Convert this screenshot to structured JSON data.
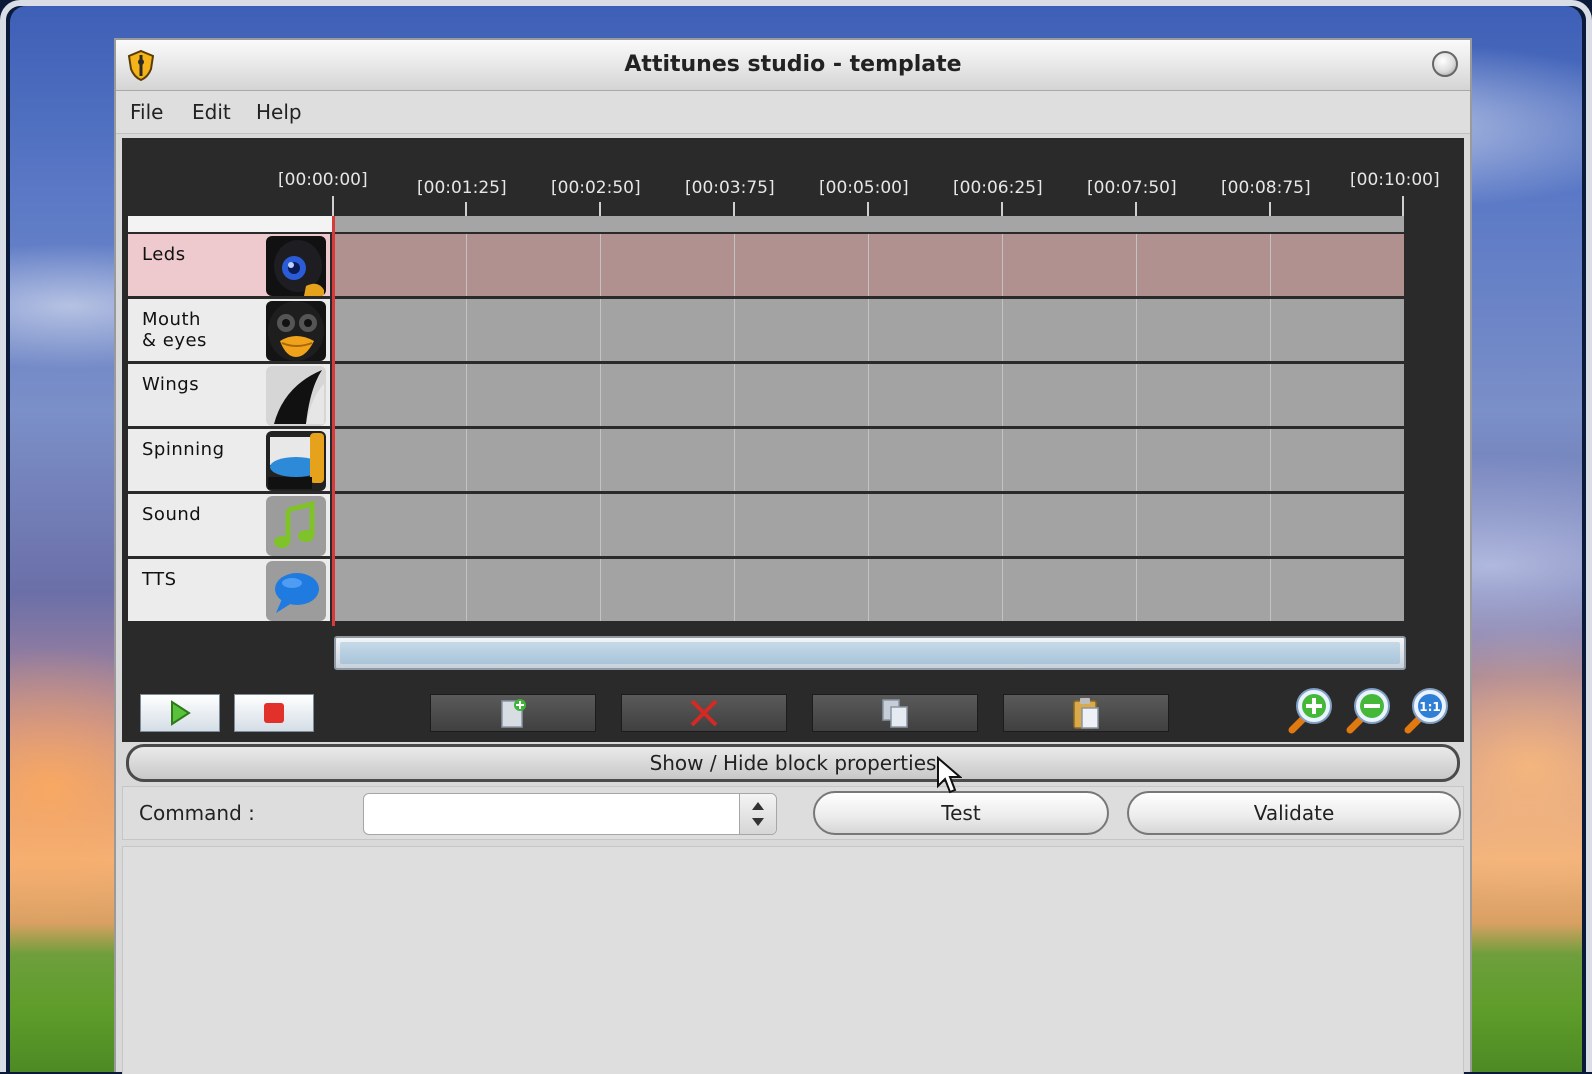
{
  "window": {
    "title": "Attitunes studio - template"
  },
  "menu": {
    "items": [
      "File",
      "Edit",
      "Help"
    ]
  },
  "timeline": {
    "ruler_labels": [
      "[00:00:00]",
      "[00:01:25]",
      "[00:02:50]",
      "[00:03:75]",
      "[00:05:00]",
      "[00:06:25]",
      "[00:07:50]",
      "[00:08:75]",
      "[00:10:00]"
    ],
    "tracks": [
      {
        "name": "Leds",
        "icon": "tux-leds-icon",
        "active": true
      },
      {
        "name": "Mouth\n& eyes",
        "icon": "tux-mouth-eyes-icon",
        "active": false
      },
      {
        "name": "Wings",
        "icon": "tux-wings-icon",
        "active": false
      },
      {
        "name": "Spinning",
        "icon": "tux-spinning-icon",
        "active": false
      },
      {
        "name": "Sound",
        "icon": "music-note-icon",
        "active": false
      },
      {
        "name": "TTS",
        "icon": "speech-bubble-icon",
        "active": false
      }
    ],
    "colors": {
      "active_track": "#eec9cd",
      "active_lane": "#b19090",
      "playhead": "#d83a3a"
    }
  },
  "toolbar": {
    "play_icon": "play-icon",
    "stop_icon": "stop-icon",
    "add_icon": "add-block-icon",
    "delete_icon": "delete-block-icon",
    "copy_icon": "copy-icon",
    "paste_icon": "paste-icon",
    "zoom_in_icon": "zoom-in-icon",
    "zoom_out_icon": "zoom-out-icon",
    "zoom_reset_label": "1:1"
  },
  "properties": {
    "toggle_label": "Show / Hide block properties",
    "command_label": "Command :",
    "command_value": "",
    "test_label": "Test",
    "validate_label": "Validate"
  }
}
